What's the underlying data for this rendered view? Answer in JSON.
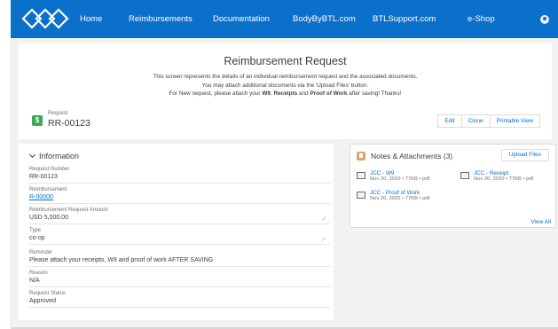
{
  "nav": {
    "links": [
      "Home",
      "Reimbursements",
      "Documentation",
      "BodyByBTL.com",
      "BTLSupport.com",
      "e-Shop"
    ]
  },
  "header": {
    "title": "Reimbursement Request",
    "desc_line1": "This screen represents the details of an individual reimbursement request and the associated documents.",
    "desc_line2": "You may attach additional documents via the 'Upload Files' button.",
    "desc_line3_pre": "For New request, please attach your ",
    "desc_w9": "W9",
    "desc_sep": ", ",
    "desc_receipts": "Receipts",
    "desc_and": " and ",
    "desc_pow": "Proof of Work",
    "desc_post": " after saving!  Thanks!"
  },
  "record": {
    "label": "Request",
    "value": "RR-00123",
    "actions": [
      "Edit",
      "Clone",
      "Printable View"
    ]
  },
  "information": {
    "title": "Information",
    "fields": [
      {
        "label": "Request Number",
        "value": "RR-00123"
      },
      {
        "label": "Reimbursement",
        "value": "R-00000"
      },
      {
        "label": "Reimbursement Request Amount",
        "value": "USD 5,000.00"
      },
      {
        "label": "Type",
        "value": "co-op"
      },
      {
        "label": "Reminder",
        "value": "Please attach your receipts, W9 and proof of work AFTER SAVING"
      },
      {
        "label": "Reason",
        "value": "N/A"
      },
      {
        "label": "Request Status",
        "value": "Approved"
      }
    ]
  },
  "notes": {
    "title": "Notes & Attachments (3)",
    "upload_label": "Upload Files",
    "files": [
      {
        "name": "JCC - W9",
        "meta": "Nov 20, 2020 • 77KB • pdf"
      },
      {
        "name": "JCC - Receipt",
        "meta": "Nov 20, 2020 • 77KB • pdf"
      },
      {
        "name": "JCC - Proof of Work",
        "meta": "Nov 20, 2020 • 77KB • pdf"
      }
    ],
    "view_all": "View All"
  },
  "colors": {
    "nav": "#0b70c9",
    "link": "#0070d2",
    "record_icon": "#3ba755",
    "notes_icon": "#d8a46e"
  }
}
